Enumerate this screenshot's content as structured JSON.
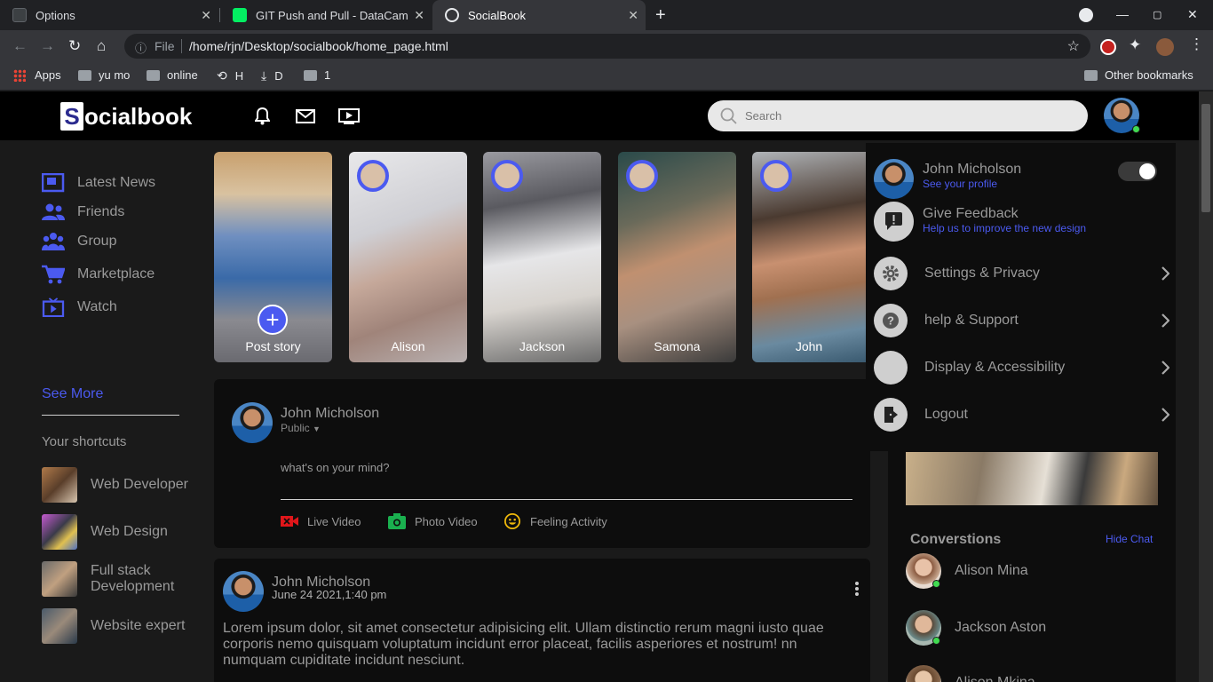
{
  "browser": {
    "tabs": [
      {
        "title": "Options",
        "favicon_color": "#202124"
      },
      {
        "title": "GIT Push and Pull - DataCam",
        "favicon_color": "#03ef62"
      },
      {
        "title": "SocialBook",
        "favicon_color": "#e8eaed"
      }
    ],
    "address": {
      "scheme_label": "File",
      "url": "/home/rjn/Desktop/socialbook/home_page.html"
    },
    "bookmarks": [
      {
        "label": "Apps",
        "icon": "apps-grid-icon"
      },
      {
        "label": "yu mo",
        "icon": "folder-icon"
      },
      {
        "label": "online",
        "icon": "folder-icon"
      },
      {
        "label": "H",
        "icon": "history-icon"
      },
      {
        "label": "D",
        "icon": "download-icon"
      },
      {
        "label": "1",
        "icon": "folder-icon"
      }
    ],
    "other_bookmarks": "Other bookmarks"
  },
  "navbar": {
    "logo_letter": "S",
    "logo_rest": "ocialbook",
    "search_placeholder": "Search"
  },
  "sidebar": {
    "items": [
      {
        "label": "Latest News",
        "icon": "news-icon"
      },
      {
        "label": "Friends",
        "icon": "friends-icon"
      },
      {
        "label": "Group",
        "icon": "group-icon"
      },
      {
        "label": "Marketplace",
        "icon": "cart-icon"
      },
      {
        "label": "Watch",
        "icon": "tv-icon"
      }
    ],
    "see_more": "See More",
    "shortcuts_title": "Your shortcuts",
    "shortcuts": [
      {
        "label": "Web Developer"
      },
      {
        "label": "Web Design"
      },
      {
        "label": "Full stack Development"
      },
      {
        "label": "Website expert"
      }
    ]
  },
  "stories": [
    {
      "name": "Post story"
    },
    {
      "name": "Alison"
    },
    {
      "name": "Jackson"
    },
    {
      "name": "Samona"
    },
    {
      "name": "John"
    }
  ],
  "post_box": {
    "user": "John Micholson",
    "privacy": "Public",
    "placeholder": "what's on your mind?",
    "actions": [
      {
        "label": "Live Video",
        "color": "#e0161a"
      },
      {
        "label": "Photo Video",
        "color": "#1ab04f"
      },
      {
        "label": "Feeling Activity",
        "color": "#f0b90b"
      }
    ]
  },
  "post": {
    "user": "John Micholson",
    "date": "June 24 2021,1:40 pm",
    "text": "Lorem ipsum dolor, sit amet consectetur adipisicing elit. Ullam distinctio rerum magni iusto quae corporis nemo quisquam voluptatum incidunt error placeat, facilis asperiores et nostrum! nn numquam cupiditate incidunt nesciunt."
  },
  "rightbar": {
    "conversations_title": "Converstions",
    "hide_chat": "Hide Chat",
    "chats": [
      {
        "name": "Alison Mina",
        "online": true
      },
      {
        "name": "Jackson Aston",
        "online": true
      },
      {
        "name": "Alison Mkina",
        "online": false
      }
    ]
  },
  "settings_menu": {
    "profile_name": "John Micholson",
    "profile_sub": "See your profile",
    "dark_mode_on": true,
    "feedback_title": "Give Feedback",
    "feedback_sub": "Help us to improve the new design",
    "links": [
      {
        "label": "Settings & Privacy",
        "icon": "gear-icon"
      },
      {
        "label": "help & Support",
        "icon": "help-icon"
      },
      {
        "label": "Display & Accessibility",
        "icon": "moon-icon"
      },
      {
        "label": "Logout",
        "icon": "logout-icon"
      }
    ]
  },
  "colors": {
    "accent": "#4b5af0",
    "online": "#41db51",
    "page_bg": "#1a1a1a",
    "card_bg": "#0d0d0d"
  }
}
